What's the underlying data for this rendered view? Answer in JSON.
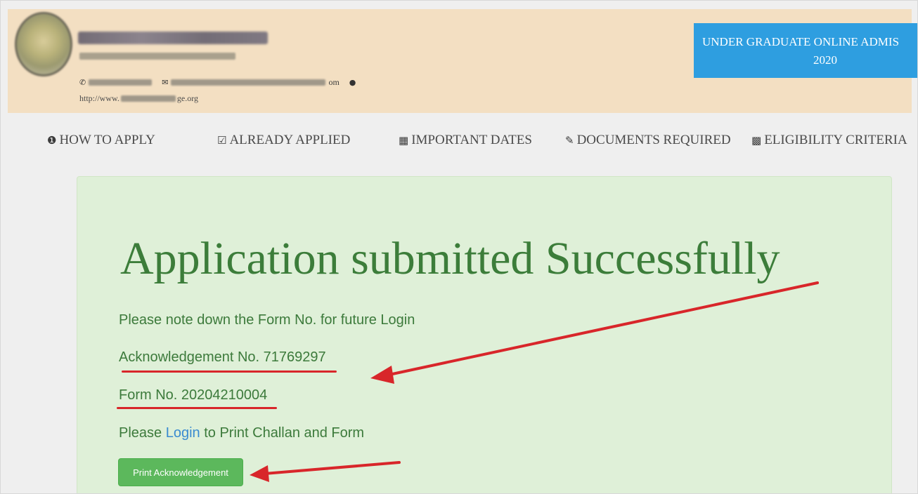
{
  "header": {
    "contact_email_suffix": "om",
    "website": "http://www.",
    "website_suffix": "ge.org",
    "banner_line1": "UNDER GRADUATE ONLINE ADMIS",
    "banner_line2": "2020",
    "background_color": "#f3dfc2",
    "banner_color": "#2e9ee0"
  },
  "nav": {
    "items": [
      {
        "label": "HOW TO APPLY",
        "icon": "info-circle-icon"
      },
      {
        "label": "ALREADY APPLIED",
        "icon": "check-square-icon"
      },
      {
        "label": "IMPORTANT DATES",
        "icon": "calendar-icon"
      },
      {
        "label": "DOCUMENTS REQUIRED",
        "icon": "edit-icon"
      },
      {
        "label": "ELIGIBILITY CRITERIA",
        "icon": "qrcode-icon"
      }
    ]
  },
  "main": {
    "title": "Application submitted Successfully",
    "note": "Please note down the Form No. for future Login",
    "acknowledgement": "Acknowledgement No. 71769297",
    "form_no": "Form No. 20204210004",
    "login_prefix": "Please ",
    "login_link": "Login",
    "login_suffix": " to Print Challan and Form",
    "print_button": "Print Acknowledgement",
    "panel_color": "#dff0d8",
    "text_color": "#3c7a3b",
    "annotation_color": "#d8262a"
  }
}
